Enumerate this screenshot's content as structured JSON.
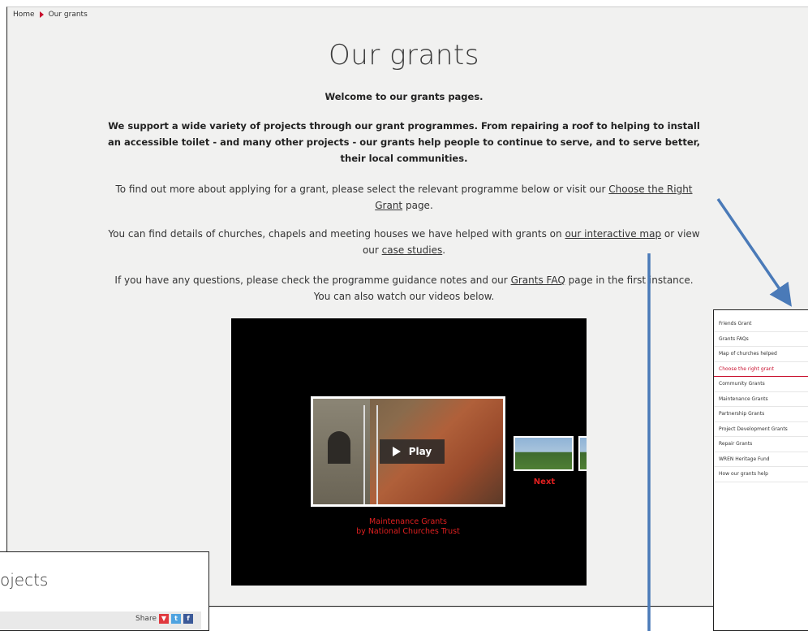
{
  "breadcrumb": {
    "home": "Home",
    "current": "Our grants"
  },
  "page": {
    "title": "Our grants",
    "welcome": "Welcome to our grants pages.",
    "intro": "We support a wide variety of projects through our grant programmes. From repairing a roof to helping to install an accessible toilet - and many other projects - our grants help people to continue to serve, and to serve better, their local communities.",
    "find_out_prefix": "To find out more about applying for a grant, please select the relevant programme below or visit our",
    "choose_link": "Choose the Right Grant",
    "find_out_suffix": "page.",
    "details_prefix": "You can find details of churches, chapels and meeting houses we have helped with grants on",
    "map_link": "our interactive map",
    "details_mid": "or view our",
    "case_link": "case studies",
    "details_suffix": ".",
    "questions_prefix": "If you have any questions, please check the programme guidance notes and our",
    "faq_link": "Grants FAQ",
    "questions_suffix": "page in the first instance. You can also watch our videos below."
  },
  "video": {
    "play_label": "Play",
    "next_label": "Next",
    "caption_line1": "Maintenance Grants",
    "caption_line2": "by National Churches Trust"
  },
  "sidebar": {
    "items": [
      {
        "label": "Friends Grant"
      },
      {
        "label": "Grants FAQs"
      },
      {
        "label": "Map of churches helped"
      },
      {
        "label": "Choose the right grant",
        "active": true
      },
      {
        "label": "Community Grants"
      },
      {
        "label": "Maintenance Grants"
      },
      {
        "label": "Partnership Grants"
      },
      {
        "label": "Project Development Grants"
      },
      {
        "label": "Repair Grants"
      },
      {
        "label": "WREN Heritage Fund"
      },
      {
        "label": "How our grants help"
      }
    ]
  },
  "cutout": {
    "title": "ojects",
    "share_label": "Share"
  },
  "colors": {
    "accent_red": "#c8102e",
    "arrow_blue": "#4a7ab8",
    "video_red": "#e02020"
  }
}
